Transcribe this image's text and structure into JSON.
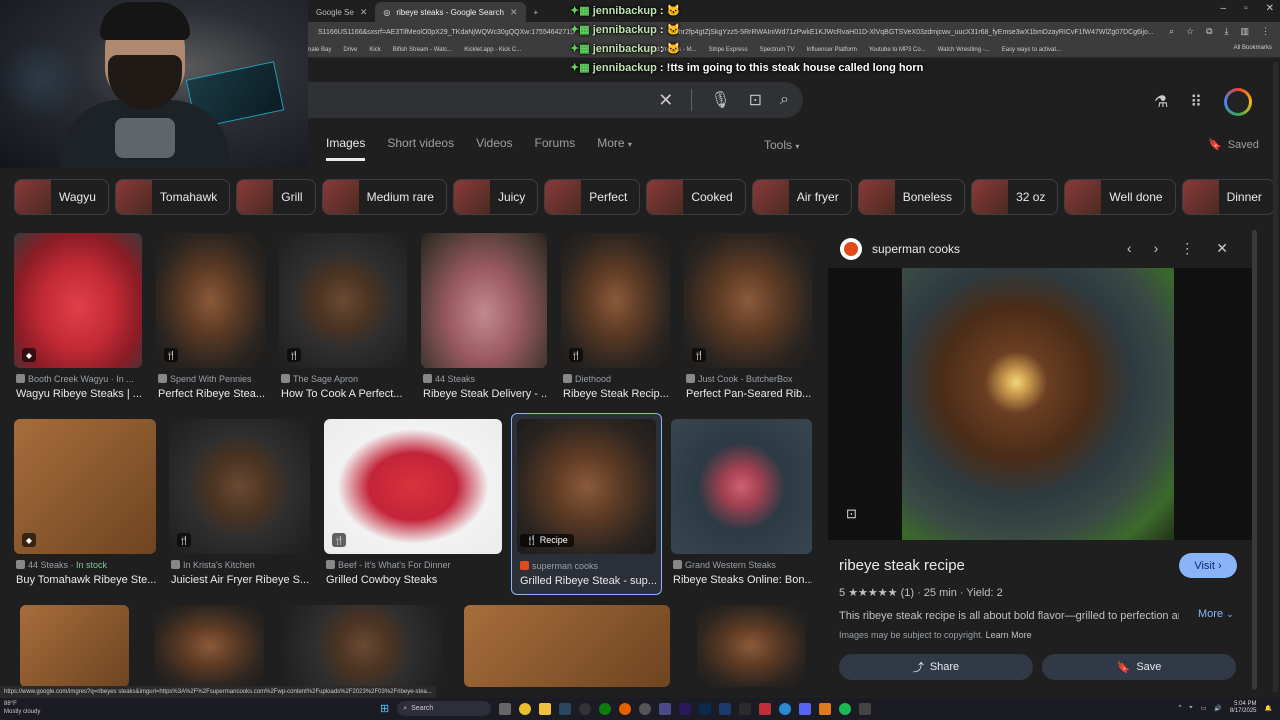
{
  "browser": {
    "tabs": [
      {
        "label": "Google Se",
        "active": false
      },
      {
        "label": "ribeye steaks - Google Search",
        "active": true
      }
    ],
    "new_tab": "+",
    "url": "S1166US1166&sxsrf=AE3TifMeolO0pX29_TKdaNjWQWc30gQQXw:17554642715",
    "url_tail": "Shr2fp4gtZjSkgYzz5-5RrRWAIniWd71zPwkE1KJWcRvaH01D-XlVqBGTSVeX03zdmjcwv_uucX31r68_fyEmse3wX1bmDzayRICvF1fW47WlZg07DCg6ijo...",
    "bookmarks": [
      "nale Bay",
      "Drive",
      "Kick",
      "Bifish Stream - Watc...",
      "Kicklet.app - Kick C...",
      "sound Imports - M...",
      "Stripe Express",
      "Spectrum TV",
      "Influencer Platform",
      "Youtube to MP3 Co...",
      "Watch Wrestling -...",
      "Easy ways to activat..."
    ],
    "all_bookmarks": "All Bookmarks"
  },
  "chat": [
    {
      "user": "jennibackup",
      "message": ""
    },
    {
      "user": "jennibackup",
      "message": ""
    },
    {
      "user": "jennibackup",
      "message": ""
    },
    {
      "user": "jennibackup",
      "message": "!tts im going to this steak house called long horn"
    }
  ],
  "nav": {
    "tabs": [
      "Images",
      "Short videos",
      "Videos",
      "Forums",
      "More"
    ],
    "tools": "Tools",
    "saved": "Saved"
  },
  "chips": [
    "Wagyu",
    "Tomahawk",
    "Grill",
    "Medium rare",
    "Juicy",
    "Perfect",
    "Cooked",
    "Air fryer",
    "Boneless",
    "32 oz",
    "Well done",
    "Dinner"
  ],
  "row1": [
    {
      "source": "Booth Creek Wagyu · In ...",
      "title": "Wagyu Ribeye Steaks | ..."
    },
    {
      "source": "Spend With Pennies",
      "title": "Perfect Ribeye Stea..."
    },
    {
      "source": "The Sage Apron",
      "title": "How To Cook A Perfect..."
    },
    {
      "source": "44 Steaks",
      "title": "Ribeye Steak Delivery - ..."
    },
    {
      "source": "Diethood",
      "title": "Ribeye Steak Recip..."
    },
    {
      "source": "Just Cook - ButcherBox",
      "title": "Perfect Pan-Seared Rib..."
    }
  ],
  "row2": [
    {
      "source": "44 Steaks",
      "stock": "In stock",
      "title": "Buy Tomahawk Ribeye Ste..."
    },
    {
      "source": "In Krista's Kitchen",
      "title": "Juiciest Air Fryer Ribeye S..."
    },
    {
      "source": "Beef - It's What's For Dinner",
      "title": "Grilled Cowboy Steaks"
    },
    {
      "source": "superman cooks",
      "title": "Grilled Ribeye Steak - sup...",
      "pill": "Recipe"
    },
    {
      "source": "Grand Western Steaks",
      "title": "Ribeye Steaks Online: Bon..."
    }
  ],
  "panel": {
    "source": "superman cooks",
    "title": "ribeye steak recipe",
    "visit": "Visit",
    "rating": "5",
    "stars": "★★★★★",
    "reviews": "(1)",
    "time": "25 min",
    "yield": "Yield: 2",
    "description": "This ribeye steak recipe is all about bold flavor—grilled to perfection and...",
    "more": "More",
    "copyright": "Images may be subject to copyright.",
    "learn_more": "Learn More",
    "share": "Share",
    "save": "Save"
  },
  "status_url": "https://www.google.com/imgres?q=ribeyes steaks&imgurl=https%3A%2F%2Fsupermancooks.com%2Fwp-content%2Fuploads%2F2023%2F03%2Fribeye-stea...",
  "taskbar": {
    "weather_temp": "88°F",
    "weather_desc": "Mostly cloudy",
    "search": "Search",
    "time": "5:04 PM",
    "date": "8/17/2025"
  }
}
